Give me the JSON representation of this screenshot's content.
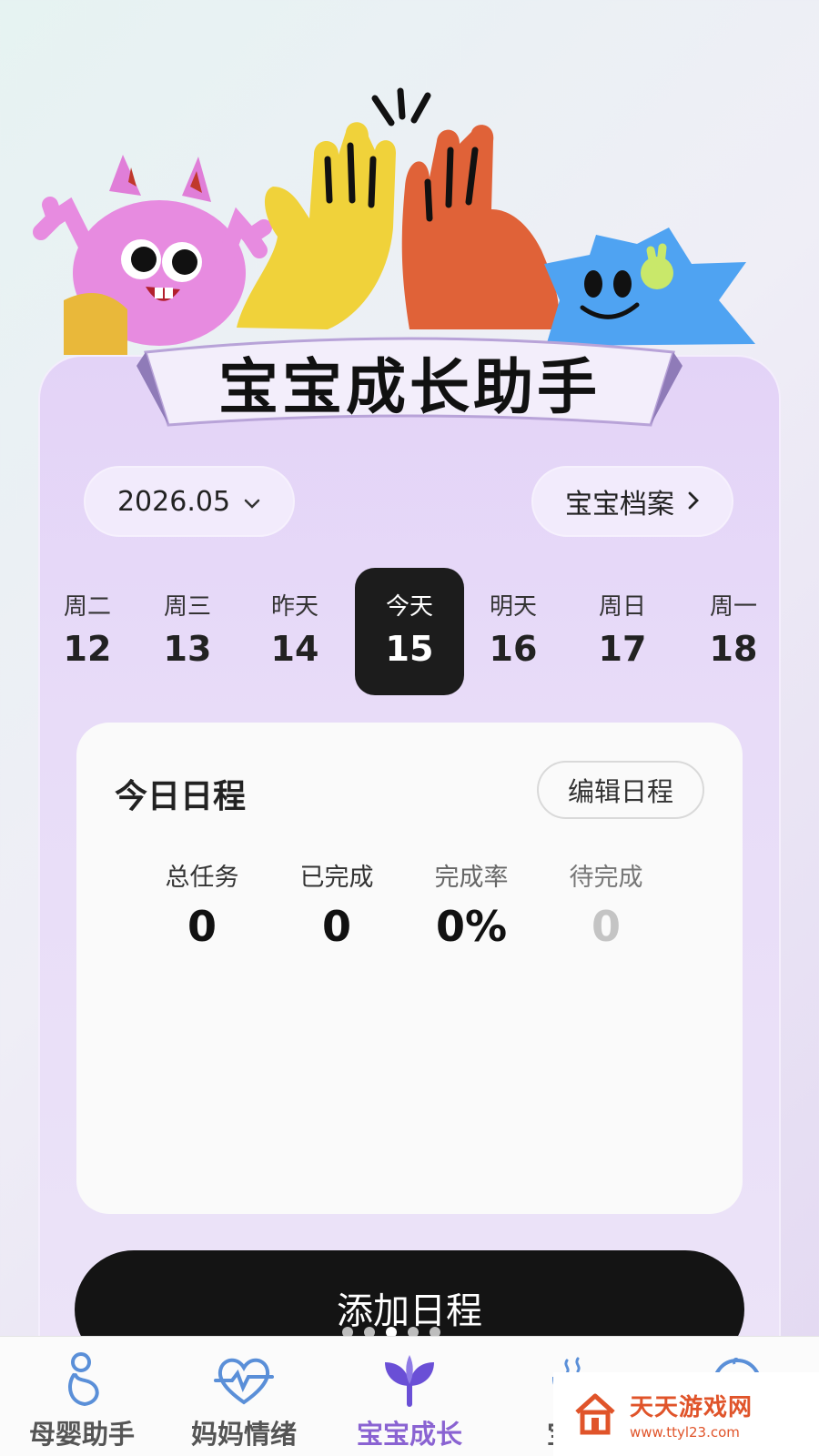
{
  "header": {
    "title": "宝宝成长助手"
  },
  "toolbar": {
    "month_label": "2026.05",
    "profile_label": "宝宝档案"
  },
  "week": [
    {
      "weekday": "周二",
      "day": "12"
    },
    {
      "weekday": "周三",
      "day": "13"
    },
    {
      "weekday": "昨天",
      "day": "14"
    },
    {
      "weekday": "今天",
      "day": "15",
      "selected": true
    },
    {
      "weekday": "明天",
      "day": "16"
    },
    {
      "weekday": "周日",
      "day": "17"
    },
    {
      "weekday": "周一",
      "day": "18"
    }
  ],
  "schedule": {
    "title": "今日日程",
    "edit_label": "编辑日程",
    "stats": [
      {
        "label": "总任务",
        "value": "0"
      },
      {
        "label": "已完成",
        "value": "0"
      },
      {
        "label": "完成率",
        "value": "0%"
      },
      {
        "label": "待完成",
        "value": "0"
      }
    ]
  },
  "add_button_label": "添加日程",
  "pager": {
    "count": 5,
    "active_index": 2
  },
  "tabs": [
    {
      "label": "母婴助手",
      "icon": "pregnancy-icon"
    },
    {
      "label": "妈妈情绪",
      "icon": "heart-pulse-icon"
    },
    {
      "label": "宝宝成长",
      "icon": "sprout-icon",
      "active": true
    },
    {
      "label": "宝宝",
      "icon": "food-bowl-icon"
    },
    {
      "label": "",
      "icon": "baby-face-icon"
    }
  ],
  "watermark": {
    "name": "天天游戏网",
    "url": "www.ttyl23.com"
  },
  "colors": {
    "accent": "#8a63d2",
    "today_bg": "#1c1c1c",
    "tab_icon": "#5a8fd8",
    "watermark": "#e0542a"
  }
}
